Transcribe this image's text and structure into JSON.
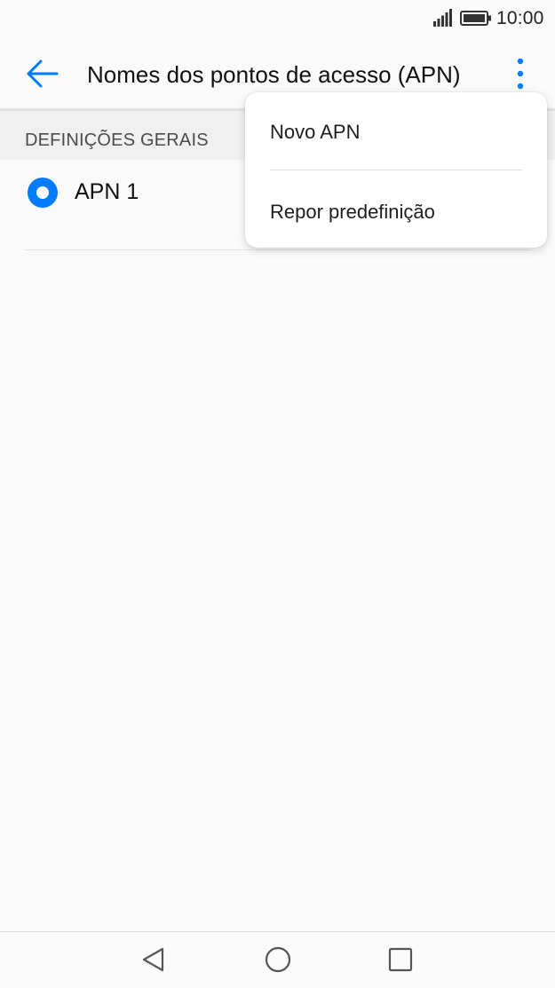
{
  "status_bar": {
    "time": "10:00",
    "signal_icon": "signal-icon",
    "battery_icon": "battery-icon"
  },
  "app_bar": {
    "title": "Nomes dos pontos de acesso (APN)",
    "back_icon": "arrow-left-icon",
    "more_icon": "more-vertical-icon"
  },
  "section": {
    "header": "DEFINIÇÕES GERAIS"
  },
  "apn_list": [
    {
      "label": "APN 1",
      "selected": true
    }
  ],
  "menu": {
    "items": [
      {
        "label": "Novo APN"
      },
      {
        "label": "Repor predefinição"
      }
    ]
  },
  "nav_bar": {
    "icons": [
      "back-triangle-icon",
      "home-circle-icon",
      "recents-square-icon"
    ]
  },
  "colors": {
    "accent": "#007dff",
    "background": "#fafafa",
    "section_bg": "#f0f0f0"
  }
}
